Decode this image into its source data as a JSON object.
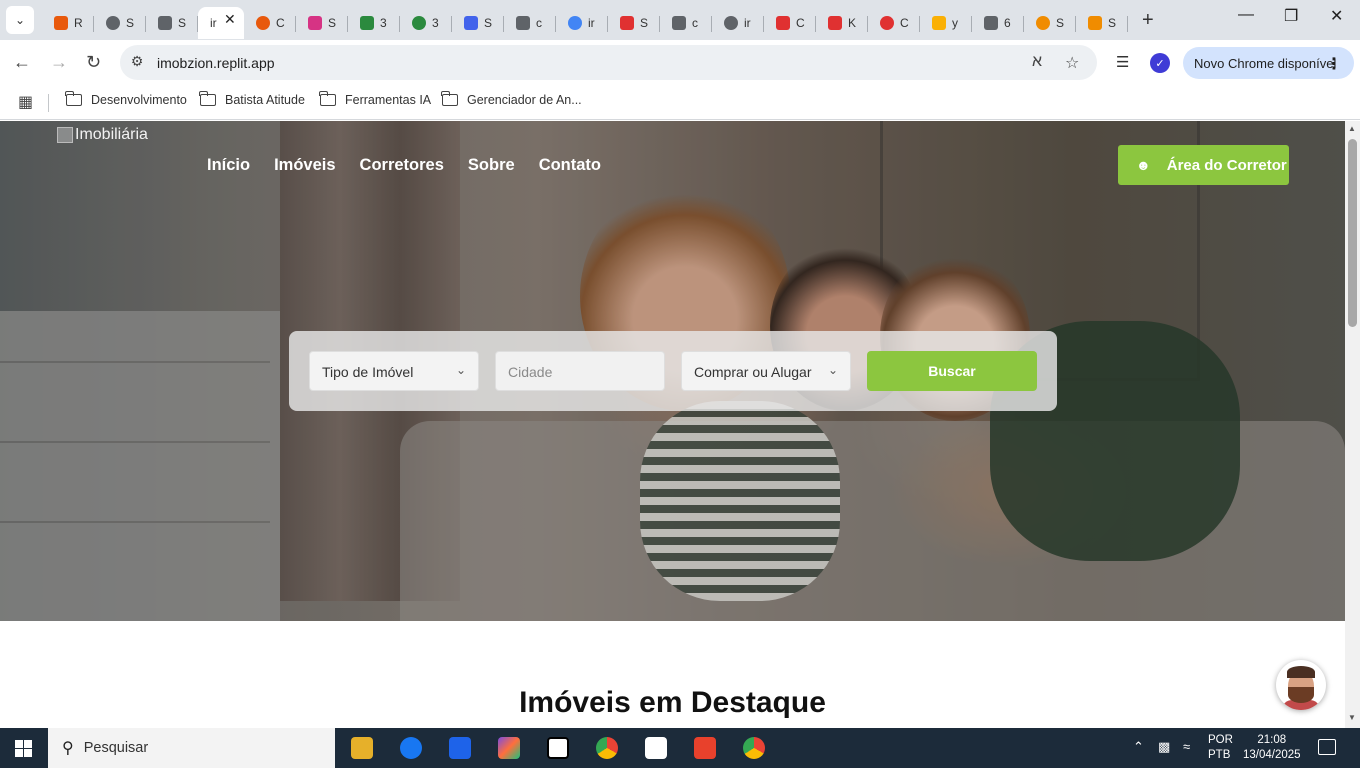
{
  "browser": {
    "tabs": [
      {
        "label": "R",
        "color": "#e8590c"
      },
      {
        "label": "S",
        "color": "#5f6368"
      },
      {
        "label": "S",
        "color": "#5f6368"
      },
      {
        "label": "ir",
        "color": "#ffffff",
        "active": true
      },
      {
        "label": "C",
        "color": "#e8590c"
      },
      {
        "label": "S",
        "color": "#d63384"
      },
      {
        "label": "3",
        "color": "#2b8a3e"
      },
      {
        "label": "3",
        "color": "#2b8a3e"
      },
      {
        "label": "S",
        "color": "#4263eb"
      },
      {
        "label": "c",
        "color": "#5f6368"
      },
      {
        "label": "ir",
        "color": "#4285f4"
      },
      {
        "label": "S",
        "color": "#e03131"
      },
      {
        "label": "c",
        "color": "#5f6368"
      },
      {
        "label": "ir",
        "color": "#5f6368"
      },
      {
        "label": "C",
        "color": "#e03131"
      },
      {
        "label": "K",
        "color": "#e03131"
      },
      {
        "label": "C",
        "color": "#e03131"
      },
      {
        "label": "y",
        "color": "#fab005"
      },
      {
        "label": "6",
        "color": "#5f6368"
      },
      {
        "label": "S",
        "color": "#f08c00"
      },
      {
        "label": "S",
        "color": "#f08c00"
      }
    ],
    "url": "imobzion.replit.app",
    "update_label": "Novo Chrome disponível",
    "bookmarks": [
      "Desenvolvimento",
      "Batista Atitude",
      "Ferramentas IA",
      "Gerenciador de An..."
    ]
  },
  "site": {
    "logo_alt": "Imobiliária",
    "nav": [
      "Início",
      "Imóveis",
      "Corretores",
      "Sobre",
      "Contato"
    ],
    "broker_button": "Área do Corretor",
    "search": {
      "property_type": "Tipo de Imóvel",
      "city_placeholder": "Cidade",
      "mode": "Comprar ou Alugar",
      "button": "Buscar"
    },
    "featured_title": "Imóveis em Destaque",
    "accent_color": "#8cc63f"
  },
  "taskbar": {
    "search_placeholder": "Pesquisar",
    "language": "POR",
    "keyboard": "PTB",
    "time": "21:08",
    "date": "13/04/2025"
  }
}
